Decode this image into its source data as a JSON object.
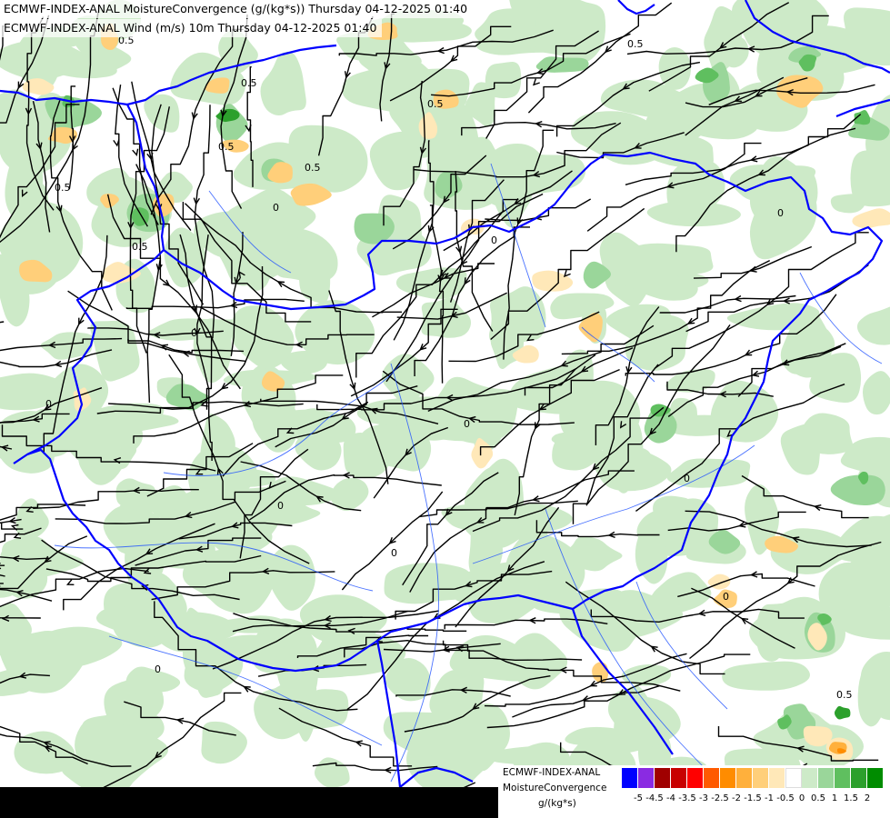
{
  "header": {
    "line1": "ECMWF-INDEX-ANAL MoistureConvergence (g/(kg*s)) Thursday 04-12-2025 01:40",
    "line2": "ECMWF-INDEX-ANAL Wind (m/s) 10m Thursday 04-12-2025 01:40"
  },
  "legend": {
    "title_line1": "ECMWF-INDEX-ANAL",
    "title_line2": "MoistureConvergence",
    "units": "g/(kg*s)",
    "ticks": [
      "-5",
      "-4.5",
      "-4",
      "-3.5",
      "-3",
      "-2.5",
      "-2",
      "-1.5",
      "-1",
      "-0.5",
      "0",
      "0.5",
      "1",
      "1.5",
      "2"
    ],
    "colors": [
      "#0000ff",
      "#8a2be2",
      "#a00000",
      "#c80000",
      "#ff0000",
      "#ff5a00",
      "#ff8c00",
      "#ffb03c",
      "#ffcf7a",
      "#ffe8b8",
      "#ffffff",
      "#cdeac8",
      "#9ad69a",
      "#5fbf5f",
      "#2ca02c",
      "#008c00"
    ]
  },
  "contour_labels": [
    "0.5",
    "0.5",
    "0.5",
    "0.5",
    "0.5",
    "0.5",
    "0.5",
    "0.5",
    "0",
    "0",
    "0",
    "0",
    "0",
    "0",
    "0",
    "0",
    "0",
    "0",
    "0.5",
    "0"
  ],
  "map": {
    "border_color": "#0000ff",
    "river_color": "#1e50ff",
    "streamline_color": "#000000",
    "layers": [
      "moisture-convergence-shading",
      "wind-streamlines",
      "country-borders",
      "rivers"
    ]
  }
}
